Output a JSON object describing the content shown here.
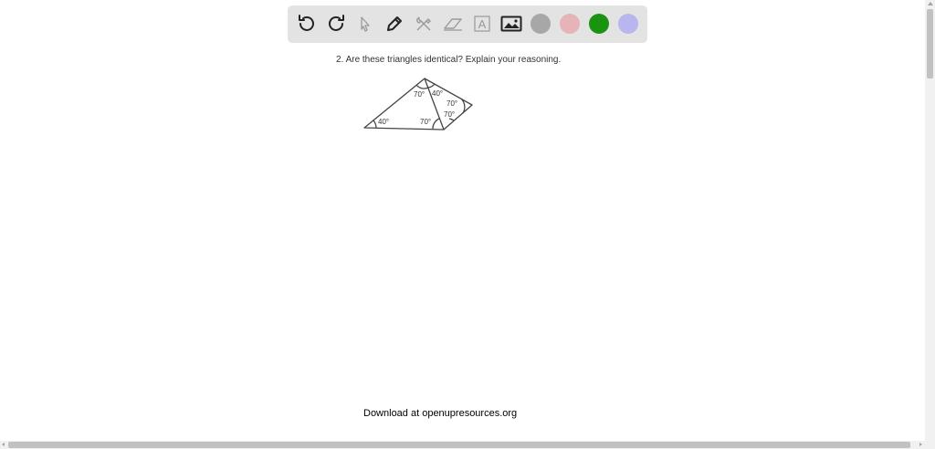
{
  "toolbar": {
    "tools": [
      {
        "id": "undo",
        "icon": "undo-icon"
      },
      {
        "id": "redo",
        "icon": "redo-icon"
      },
      {
        "id": "select",
        "icon": "cursor-arrow-icon"
      },
      {
        "id": "pen",
        "icon": "pen-icon"
      },
      {
        "id": "tools",
        "icon": "hammer-wrench-icon"
      },
      {
        "id": "eraser",
        "icon": "eraser-icon"
      },
      {
        "id": "text",
        "icon": "text-box-icon"
      },
      {
        "id": "image",
        "icon": "image-icon"
      }
    ],
    "text_tool_glyph": "A",
    "colors": [
      {
        "name": "gray",
        "hex": "#a7a7a7"
      },
      {
        "name": "pink",
        "hex": "#e6b3b9"
      },
      {
        "name": "green",
        "hex": "#1a9310"
      },
      {
        "name": "lavender",
        "hex": "#b8b6ee"
      }
    ]
  },
  "worksheet": {
    "question": "2. Are these triangles identical? Explain your reasoning.",
    "angles": {
      "top_left": "70°",
      "top_right": "40°",
      "right_upper": "70°",
      "right_lower": "70°",
      "bottom_left": "40°",
      "bottom_middle": "70°"
    }
  },
  "footer": {
    "download_text": "Download at openupresources.org"
  }
}
